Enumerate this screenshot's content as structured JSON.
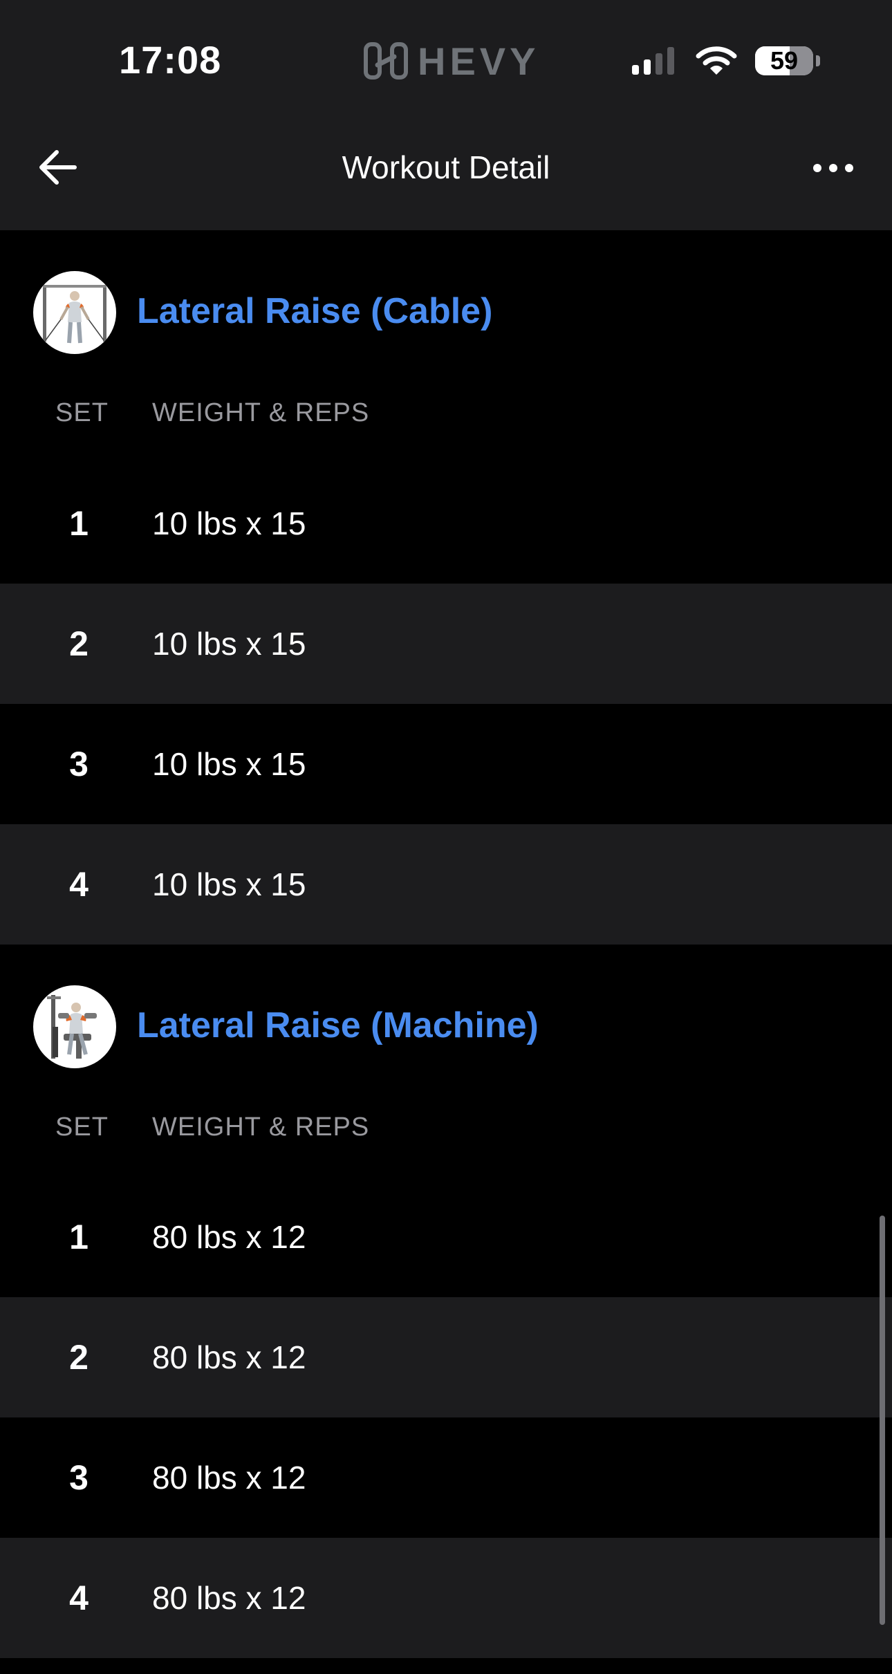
{
  "status_bar": {
    "time": "17:08",
    "app_logo_text": "HEVY",
    "battery_level": "59",
    "battery_fraction": 0.59,
    "icons": [
      "cellular-signal-icon",
      "wifi-icon",
      "battery-icon"
    ]
  },
  "nav": {
    "title": "Workout Detail",
    "back_icon": "arrow-left-icon",
    "more_icon": "more-horizontal-icon"
  },
  "colors": {
    "accent": "#4a8cf0",
    "background": "#000000",
    "header_background": "#1c1c1e",
    "row_alt": "#1c1c1e",
    "muted_text": "#9a9a9f"
  },
  "exercises": [
    {
      "name": "Lateral Raise (Cable)",
      "thumbnail_icon": "cable-lateral-raise-illustration",
      "columns": {
        "set": "SET",
        "weight_reps": "WEIGHT & REPS"
      },
      "sets": [
        {
          "set": "1",
          "value": "10 lbs x 15"
        },
        {
          "set": "2",
          "value": "10 lbs x 15"
        },
        {
          "set": "3",
          "value": "10 lbs x 15"
        },
        {
          "set": "4",
          "value": "10 lbs x 15"
        }
      ]
    },
    {
      "name": "Lateral Raise (Machine)",
      "thumbnail_icon": "machine-lateral-raise-illustration",
      "columns": {
        "set": "SET",
        "weight_reps": "WEIGHT & REPS"
      },
      "sets": [
        {
          "set": "1",
          "value": "80 lbs x 12"
        },
        {
          "set": "2",
          "value": "80 lbs x 12"
        },
        {
          "set": "3",
          "value": "80 lbs x 12"
        },
        {
          "set": "4",
          "value": "80 lbs x 12"
        }
      ]
    }
  ]
}
